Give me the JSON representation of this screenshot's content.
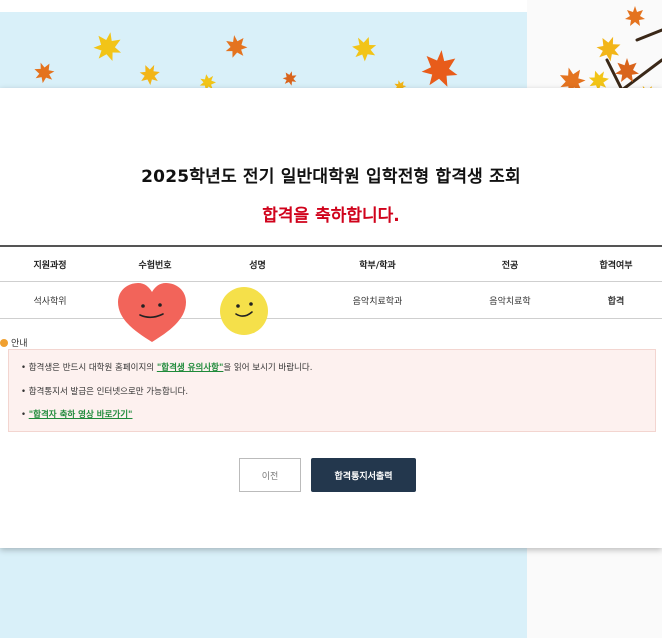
{
  "header": {
    "title": "2025학년도 전기 일반대학원 입학전형 합격생 조회",
    "subtitle": "합격을 축하합니다."
  },
  "table": {
    "columns": [
      "지원과정",
      "수험번호",
      "성명",
      "학부/학과",
      "전공",
      "합격여부"
    ],
    "row": [
      "석사학위",
      "",
      "",
      "음악치료학과",
      "음악치료학",
      "합격"
    ]
  },
  "notice": {
    "heading": "안내",
    "line1_before": "• 합격생은 반드시 대학원 홈페이지의 ",
    "line1_link": "\"합격생 유의사항\"",
    "line1_after": "을 읽어 보시기 바랍니다.",
    "line2": "• 합격통지서 발급은 인터넷으로만 가능합니다.",
    "line3_bullet": "• ",
    "line3_link": "\"합격자 축하 영상 바로가기\""
  },
  "buttons": {
    "prev_label": "이전",
    "print_label": "합격통지서출력"
  },
  "colors": {
    "accent_red": "#d0021b",
    "link_green": "#1f8a3a",
    "primary_button": "#23374d",
    "background_sky": "#d9f0f9",
    "heart_sticker": "#f2645a",
    "smiley_sticker": "#f5e04a"
  },
  "decorations": {
    "leaves": "autumn-maple-leaves",
    "branch": "tree-branch-with-autumn-leaves",
    "stickers": [
      "heart-face-sticker",
      "smiley-face-sticker"
    ]
  }
}
